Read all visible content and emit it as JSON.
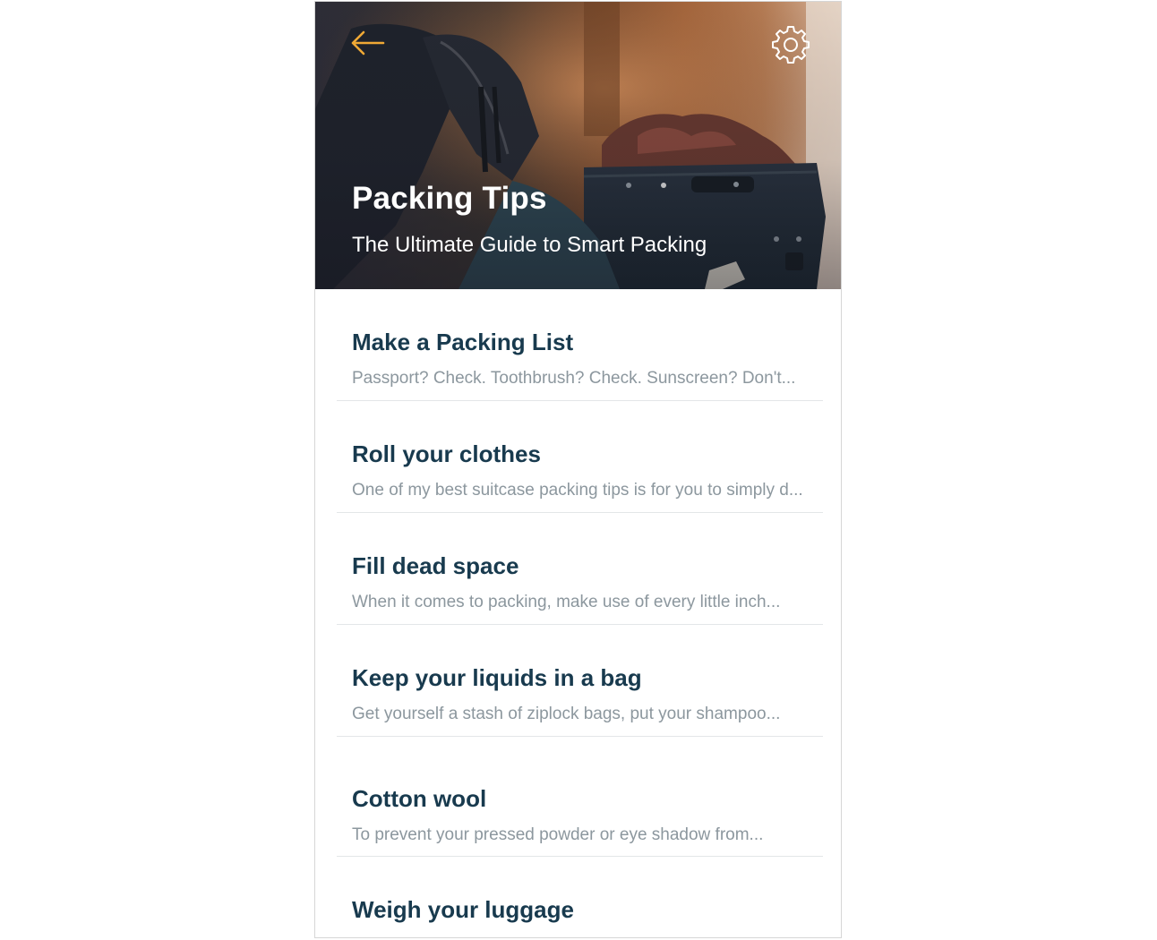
{
  "header": {
    "title": "Packing Tips",
    "subtitle": "The Ultimate Guide to Smart Packing",
    "back_icon": "arrow-left-icon",
    "settings_icon": "gear-icon",
    "accent_color": "#f0a935"
  },
  "tips": [
    {
      "title": "Make a Packing List",
      "excerpt": "Passport? Check. Toothbrush? Check. Sunscreen? Don't..."
    },
    {
      "title": "Roll your clothes",
      "excerpt": "One of my best suitcase packing tips is for you to simply d..."
    },
    {
      "title": "Fill dead space",
      "excerpt": "When it comes to packing, make use of every little inch..."
    },
    {
      "title": "Keep your liquids in a bag",
      "excerpt": "Get yourself a stash of ziplock bags, put your shampoo..."
    },
    {
      "title": "Cotton wool",
      "excerpt": "To prevent your pressed powder or eye shadow from..."
    },
    {
      "title": "Weigh your luggage",
      "excerpt": ""
    }
  ],
  "colors": {
    "title_text": "#183a4e",
    "excerpt_text": "#8c979e",
    "divider": "#e3e6e8"
  }
}
